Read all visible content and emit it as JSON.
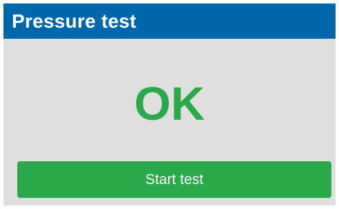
{
  "header": {
    "title": "Pressure test"
  },
  "status": {
    "text": "OK",
    "color": "#2aa94a"
  },
  "actions": {
    "start_label": "Start test"
  },
  "colors": {
    "header_background": "#0068aa",
    "panel_background": "#dfdfdf",
    "button_background": "#2aa94a"
  }
}
